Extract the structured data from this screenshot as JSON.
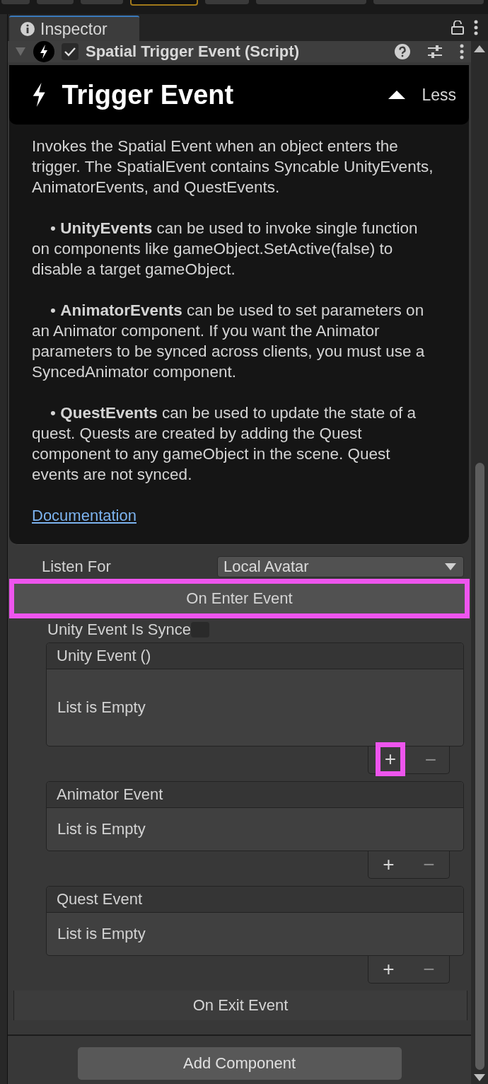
{
  "window": {
    "tab": {
      "label": "Inspector",
      "selected": true
    }
  },
  "component": {
    "title": "Spatial Trigger Event (Script)",
    "enabled": true,
    "expanded": true
  },
  "help": {
    "title": "Trigger Event",
    "toggle": "Less",
    "paragraphs": [
      "Invokes the Spatial Event when an object enters the trigger. The SpatialEvent contains Syncable UnityEvents, AnimatorEvents, and QuestEvents.",
      "• **UnityEvents** can be used to invoke single function on components like gameObject.SetActive(false) to disable a target gameObject.",
      "• **AnimatorEvents** can be used to set parameters on an Animator component. If you want the Animator parameters to be synced across clients, you must use a SyncedAnimator component.",
      "• **QuestEvents** can be used to update the state of a quest. Quests are created by adding the Quest component to any gameObject in the scene. Quest events are not synced."
    ],
    "link": "Documentation"
  },
  "listen_for": {
    "label": "Listen For",
    "value": "Local Avatar"
  },
  "on_enter": {
    "label": "On Enter Event",
    "highlighted": true
  },
  "synced": {
    "label": "Unity Event Is Synce",
    "checked": false
  },
  "event_lists": [
    {
      "kind": "unity",
      "title": "Unity Event ()",
      "empty": "List is Empty",
      "add": "+",
      "remove": "−",
      "add_highlighted": true
    },
    {
      "kind": "list",
      "title": "Animator Event",
      "empty": "List is Empty",
      "add": "+",
      "remove": "−",
      "add_highlighted": false
    },
    {
      "kind": "list",
      "title": "Quest Event",
      "empty": "List is Empty",
      "add": "+",
      "remove": "−",
      "add_highlighted": false
    }
  ],
  "on_exit": {
    "label": "On Exit Event",
    "highlighted": false
  },
  "add_component": "Add Component"
}
